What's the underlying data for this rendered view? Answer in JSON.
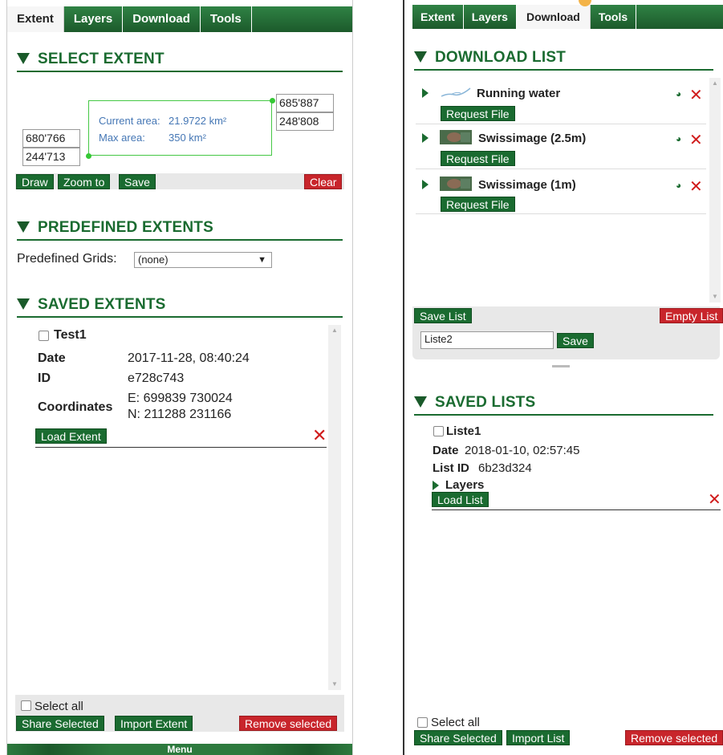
{
  "left": {
    "tabs": [
      "Extent",
      "Layers",
      "Download",
      "Tools"
    ],
    "select_extent": {
      "title": "SELECT EXTENT",
      "top_right": [
        "685'887",
        "248'808"
      ],
      "bottom_left": [
        "680'766",
        "244'713"
      ],
      "current_area_label": "Current area:",
      "current_area_value": "21.9722 km²",
      "max_area_label": "Max area:",
      "max_area_value": "350 km²",
      "buttons": {
        "draw": "Draw",
        "zoom_to": "Zoom to",
        "save": "Save",
        "clear": "Clear"
      }
    },
    "predefined": {
      "title": "PREDEFINED EXTENTS",
      "grids_label": "Predefined Grids:",
      "grids_value": "(none)"
    },
    "saved": {
      "title": "SAVED EXTENTS",
      "item": {
        "name": "Test1",
        "date_label": "Date",
        "date_value": "2017-11-28, 08:40:24",
        "id_label": "ID",
        "id_value": "e728c743",
        "coords_label": "Coordinates",
        "coords_e": "E: 699839 730024",
        "coords_n": "N: 211288 231166",
        "load_label": "Load Extent"
      }
    },
    "footer": {
      "select_all": "Select all",
      "share": "Share Selected",
      "import": "Import Extent",
      "remove": "Remove selected",
      "menu": "Menu"
    }
  },
  "right": {
    "tabs": [
      "Extent",
      "Layers",
      "Download",
      "Tools"
    ],
    "download_list": {
      "title": "DOWNLOAD LIST",
      "items": [
        {
          "name": "Running water",
          "request": "Request File"
        },
        {
          "name": "Swissimage (2.5m)",
          "request": "Request File"
        },
        {
          "name": "Swissimage (1m)",
          "request": "Request File"
        }
      ],
      "save_list": "Save List",
      "empty_list": "Empty List",
      "list_name_value": "Liste2",
      "save": "Save"
    },
    "saved_lists": {
      "title": "SAVED LISTS",
      "item": {
        "name": "Liste1",
        "date_label": "Date",
        "date_value": "2018-01-10, 02:57:45",
        "id_label": "List ID",
        "id_value": "6b23d324",
        "layers_label": "Layers",
        "load_label": "Load List"
      }
    },
    "footer": {
      "select_all": "Select all",
      "share": "Share Selected",
      "import": "Import List",
      "remove": "Remove selected"
    }
  },
  "colors": {
    "green": "#1a6b30",
    "red": "#c8252b",
    "blue_text": "#4577b5",
    "extent_line": "#45c845"
  }
}
